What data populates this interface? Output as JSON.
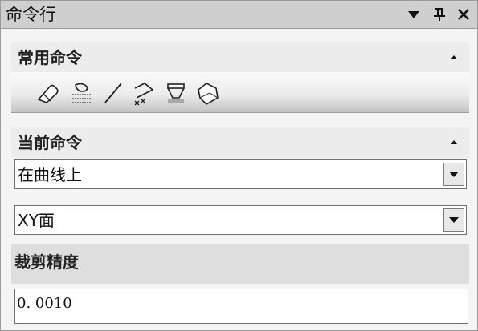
{
  "panel": {
    "title": "命令行",
    "title_icons": [
      "dropdown-arrow-icon",
      "pin-icon",
      "close-icon"
    ]
  },
  "common_commands": {
    "title": "常用命令",
    "tools": [
      "eraser-icon",
      "surface-icon",
      "line-icon",
      "trim-curve-icon",
      "cut-surface-icon",
      "solid-icon"
    ]
  },
  "current_command": {
    "title": "当前命令",
    "mode_value": "在曲线上",
    "plane_value": "XY面",
    "precision_label": "裁剪精度",
    "precision_value": "0. 0010"
  }
}
